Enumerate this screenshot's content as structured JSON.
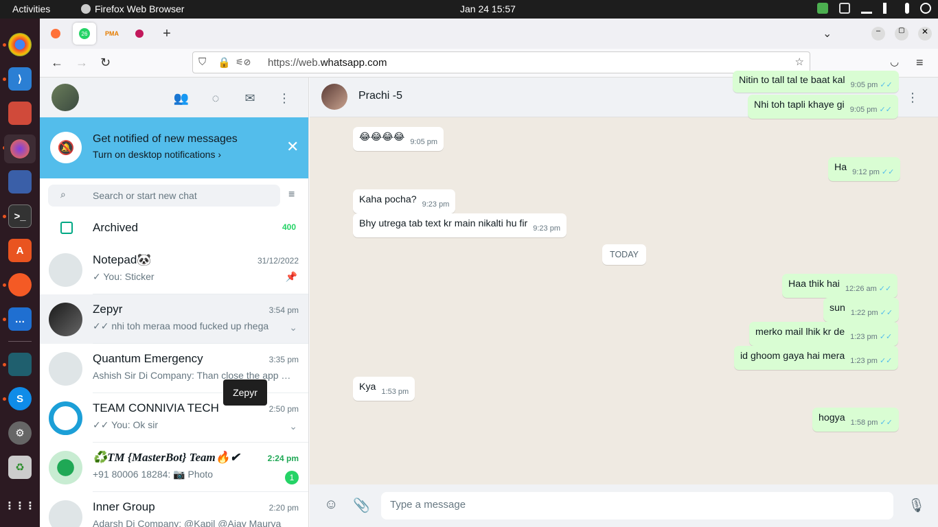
{
  "system": {
    "activities": "Activities",
    "app_name": "Firefox Web Browser",
    "clock": "Jan 24  15:57"
  },
  "browser": {
    "url_prefix": "https://web.",
    "url_domain": "whatsapp.com",
    "tab_badge": "26"
  },
  "sidebar": {
    "notification": {
      "title": "Get notified of new messages",
      "subtitle": "Turn on desktop notifications ›"
    },
    "search_placeholder": "Search or start new chat",
    "archived_label": "Archived",
    "archived_count": "400",
    "chats": [
      {
        "name": "Notepad🐼",
        "time": "31/12/2022",
        "msg": "✓ You: Sticker"
      },
      {
        "name": "Zepyr",
        "time": "3:54 pm",
        "msg": "✓✓ nhi toh meraa mood fucked up rhega"
      },
      {
        "name": "Quantum Emergency",
        "time": "3:35 pm",
        "msg": "Ashish Sir Di Company: Than close the app …"
      },
      {
        "name": "TEAM CONNIVIA TECH",
        "time": "2:50 pm",
        "msg": "✓✓ You: Ok sir"
      },
      {
        "name": "♻️TM {MasterBot} Team🔥✔",
        "time": "2:24 pm",
        "msg": "+91 80006 18284: 📷 Photo",
        "unread": "1"
      },
      {
        "name": "Inner Group",
        "time": "2:20 pm",
        "msg": "Adarsh Di Company: @Kapil @Ajay Maurya"
      }
    ],
    "tooltip": "Zepyr"
  },
  "conversation": {
    "contact_name": "Prachi -5",
    "day_chip": "TODAY",
    "messages": [
      {
        "text": "Nitin to tall tal te baat kal",
        "time": "9:05 pm",
        "dir": "out"
      },
      {
        "text": "Nhi toh tapli khaye gi",
        "time": "9:05 pm",
        "dir": "out"
      },
      {
        "text": "😂😂😂😂",
        "time": "9:05 pm",
        "dir": "in"
      },
      {
        "text": "Ha",
        "time": "9:12 pm",
        "dir": "out"
      },
      {
        "text": "Kaha pocha?",
        "time": "9:23 pm",
        "dir": "in"
      },
      {
        "text": "Bhy utrega tab text kr main nikalti hu fir",
        "time": "9:23 pm",
        "dir": "in"
      },
      {
        "text": "Haa thik hai",
        "time": "12:26 am",
        "dir": "out"
      },
      {
        "text": "sun",
        "time": "1:22 pm",
        "dir": "out"
      },
      {
        "text": "merko mail lhik kr de",
        "time": "1:23 pm",
        "dir": "out"
      },
      {
        "text": "id ghoom gaya hai mera",
        "time": "1:23 pm",
        "dir": "out"
      },
      {
        "text": "Kya",
        "time": "1:53 pm",
        "dir": "in"
      },
      {
        "text": "hogya",
        "time": "1:58 pm",
        "dir": "out"
      }
    ],
    "composer_placeholder": "Type a message"
  },
  "colors": {
    "accent": "#00a884",
    "notification_bg": "#53bdeb",
    "outgoing_bubble": "#d9fdd3",
    "chat_bg": "#efeae2",
    "tick_blue": "#53bdeb"
  }
}
